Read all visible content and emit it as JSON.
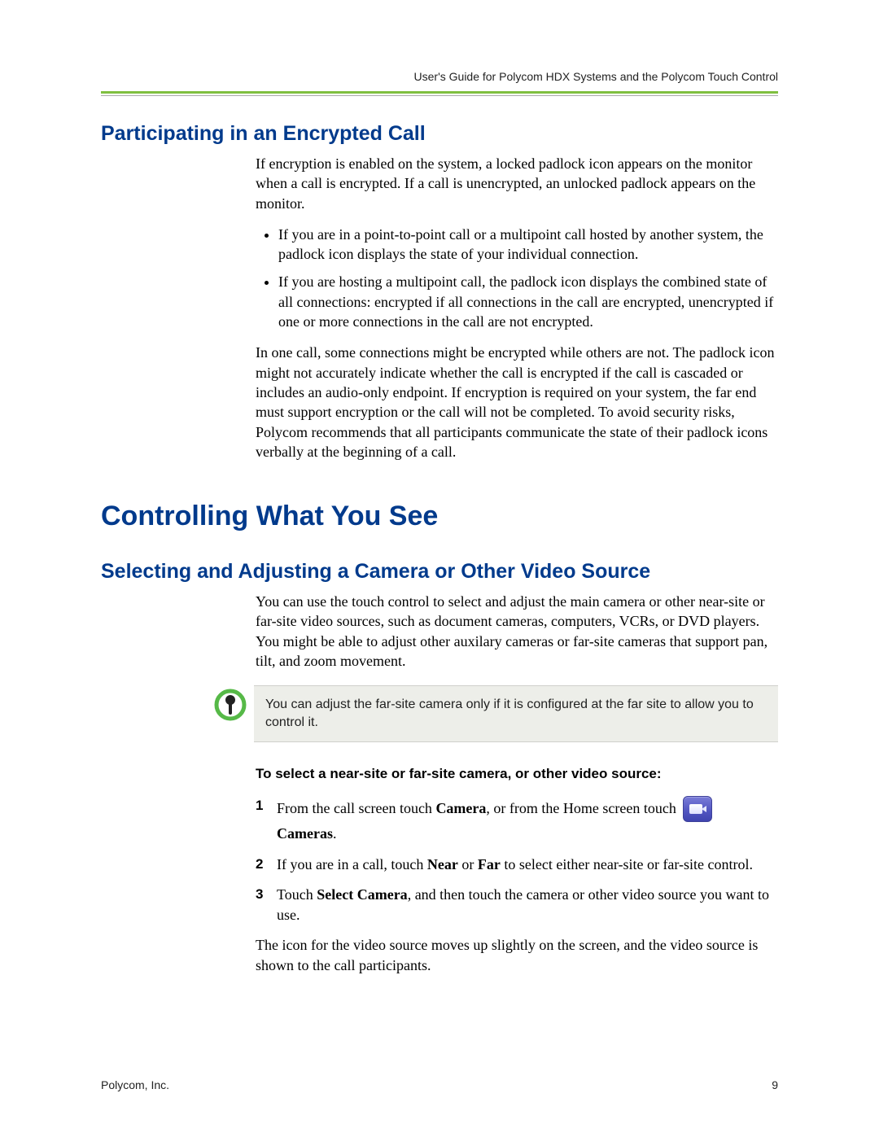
{
  "runningHead": "User's Guide for Polycom HDX Systems and the Polycom Touch Control",
  "sectionA": {
    "title": "Participating in an Encrypted Call",
    "p1": "If encryption is enabled on the system, a locked padlock icon appears on the monitor when a call is encrypted. If a call is unencrypted, an unlocked padlock appears on the monitor.",
    "b1": "If you are in a point-to-point call or a multipoint call hosted by another system, the padlock icon displays the state of your individual connection.",
    "b2": "If you are hosting a multipoint call, the padlock icon displays the combined state of all connections: encrypted if all connections in the call are encrypted, unencrypted if one or more connections in the call are not encrypted.",
    "p2": "In one call, some connections might be encrypted while others are not. The padlock icon might not accurately indicate whether the call is encrypted if the call is cascaded or includes an audio-only endpoint. If encryption is required on your system, the far end must support encryption or the call will not be completed. To avoid security risks, Polycom recommends that all participants communicate the state of their padlock icons verbally at the beginning of a call."
  },
  "chapter": "Controlling What You See",
  "sectionB": {
    "title": "Selecting and Adjusting a Camera or Other Video Source",
    "p1": "You can use the touch control to select and adjust the main camera or other near-site or far-site video sources, such as document cameras, computers, VCRs, or DVD players. You might be able to adjust other auxilary cameras or far-site cameras that support pan, tilt, and zoom movement.",
    "note": "You can adjust the far-site camera only if it is configured at the far site to allow you to control it.",
    "subhead": "To select a near-site or far-site camera, or other video source:",
    "step1_a": "From the call screen touch ",
    "step1_cam": "Camera",
    "step1_b": ", or from the Home screen touch",
    "step1_c": "Cameras",
    "step1_d": ".",
    "step2_a": "If you are in a call, touch ",
    "step2_near": "Near",
    "step2_mid": " or ",
    "step2_far": "Far",
    "step2_b": " to select either near-site or far-site control.",
    "step3_a": "Touch ",
    "step3_sel": "Select Camera",
    "step3_b": ", and then touch the camera or other video source you want to use.",
    "post": "The icon for the video source moves up slightly on the screen, and the video source is shown to the call participants."
  },
  "footer": {
    "left": "Polycom, Inc.",
    "right": "9"
  }
}
